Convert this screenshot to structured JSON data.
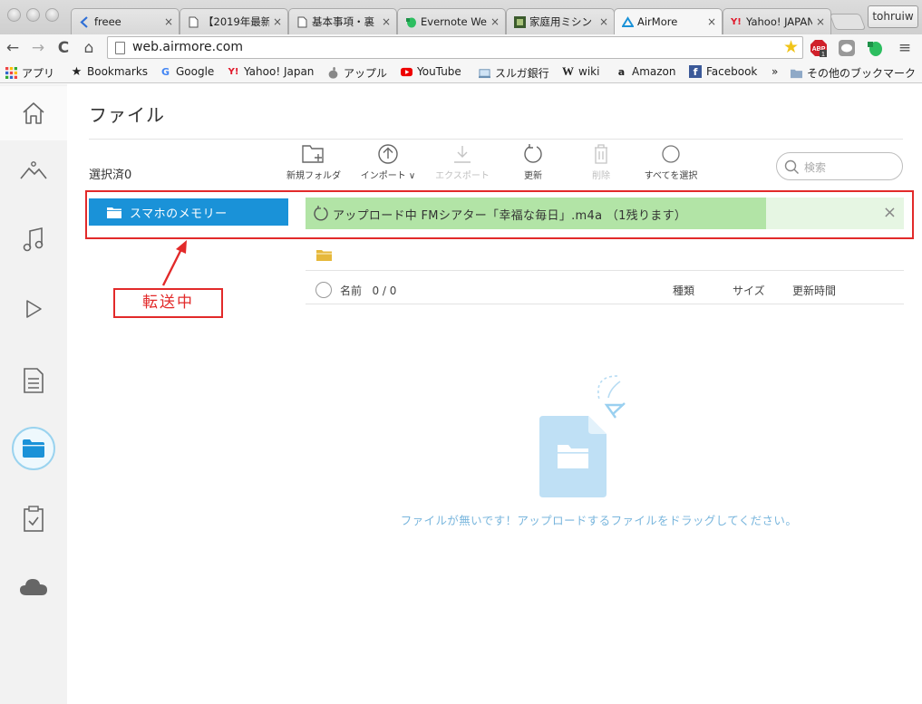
{
  "browser": {
    "tabs": [
      {
        "title": "freee",
        "icon": "freee-icon"
      },
      {
        "title": "【2019年最新",
        "icon": "page-icon"
      },
      {
        "title": "基本事項・裏",
        "icon": "page-icon"
      },
      {
        "title": "Evernote Wel",
        "icon": "evernote-icon"
      },
      {
        "title": "家庭用ミシン",
        "icon": "sewing-icon"
      },
      {
        "title": "AirMore",
        "icon": "airmore-icon",
        "active": true
      },
      {
        "title": "Yahoo! JAPAN",
        "icon": "yahoo-icon"
      }
    ],
    "tab_close_glyph": "×",
    "profile_name": "tohruiw",
    "url": "web.airmore.com",
    "nav": {
      "back": "←",
      "forward": "→",
      "reload": "C",
      "home": "⌂",
      "menu": "≡"
    },
    "extensions": {
      "abp": "ABP",
      "abp_count": "1"
    },
    "bookmarks": [
      {
        "label": "アプリ",
        "icon": "apps-grid-icon"
      },
      {
        "label": "Bookmarks",
        "icon": "star-icon"
      },
      {
        "label": "Google",
        "icon": "google-icon"
      },
      {
        "label": "Yahoo! Japan",
        "icon": "yahoo-icon"
      },
      {
        "label": "アップル",
        "icon": "apple-icon"
      },
      {
        "label": "YouTube",
        "icon": "youtube-icon"
      },
      {
        "label": "スルガ銀行",
        "icon": "bank-icon"
      },
      {
        "label": "wiki",
        "icon": "wikipedia-icon"
      },
      {
        "label": "Amazon",
        "icon": "amazon-icon"
      },
      {
        "label": "Facebook",
        "icon": "facebook-icon"
      }
    ],
    "bookmarks_overflow": "»",
    "other_bookmarks": "その他のブックマーク"
  },
  "app": {
    "sidebar": [
      "home-icon",
      "photos-icon",
      "music-icon",
      "video-icon",
      "documents-icon",
      "files-icon",
      "clipboard-icon",
      "cloud-icon"
    ],
    "page_title": "ファイル",
    "selected_label": "選択済0",
    "toolbar": {
      "new_folder": "新規フォルダ",
      "import": "インポート",
      "import_caret": "∨",
      "export": "エクスポート",
      "refresh": "更新",
      "delete": "削除",
      "select_all": "すべてを選択"
    },
    "search_placeholder": "検索",
    "phone_memory": "スマホのメモリー",
    "upload": {
      "text": "アップロード中 FMシアター「幸福な毎日」.m4a （1残ります）",
      "progress": 0.77,
      "close_glyph": "×"
    },
    "annotation": {
      "label": "転送中",
      "color": "#e22a2a"
    },
    "columns": {
      "name": "名前",
      "count": "0 / 0",
      "type": "種類",
      "size": "サイズ",
      "updated": "更新時間"
    },
    "empty_message": "ファイルが無いです！アップロードするファイルをドラッグしてください。",
    "colors": {
      "accent": "#1a92d8",
      "progress": "#b2e4a6",
      "progress_track": "#e6f6e3",
      "empty_text": "#79b6dd"
    }
  }
}
